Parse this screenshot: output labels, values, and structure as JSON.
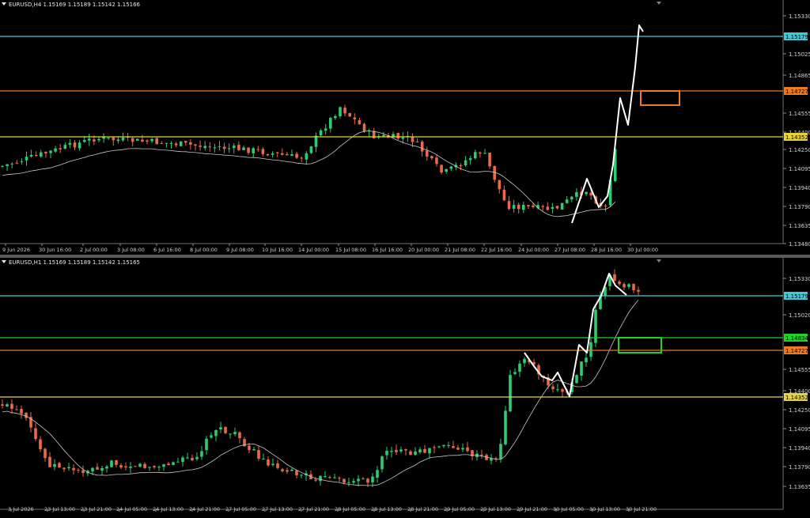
{
  "colors": {
    "background": "#000000",
    "grid": "#3a3a3a",
    "bull": "#2ecc71",
    "bear": "#e86a4a",
    "axis_text": "#d0d0d0",
    "ma": "#c8c8c8",
    "trace": "#ffffff",
    "level_cyan": "#3fc9d8",
    "level_orange": "#e87b24",
    "level_yellow": "#e6d23c",
    "level_green": "#22d12a",
    "box_orange": "#e87b24",
    "box_green": "#22d12a"
  },
  "icons": {
    "menu_marker": "triangle-down-icon"
  },
  "panes": [
    {
      "symbol": "EURUSD,H4",
      "ohlc": "1.15169 1.15189 1.15142 1.15166",
      "yaxis_ticks": [
        "1.15330",
        "1.15025",
        "1.14865",
        "1.14555",
        "1.14400",
        "1.14250",
        "1.14095",
        "1.13940",
        "1.13790",
        "1.13635",
        "1.13480"
      ],
      "xaxis_labels": [
        "9 Jun 2026",
        "30 Jun 16:00",
        "2 Jul 00:00",
        "3 Jul 08:00",
        "6 Jul 16:00",
        "8 Jul 00:00",
        "9 Jul 08:00",
        "10 Jul 16:00",
        "14 Jul 00:00",
        "15 Jul 08:00",
        "16 Jul 16:00",
        "20 Jul 00:00",
        "21 Jul 08:00",
        "22 Jul 16:00",
        "24 Jul 00:00",
        "27 Jul 08:00",
        "28 Jul 16:00",
        "30 Jul 00:00"
      ],
      "level_labels": [
        {
          "role": "cyan",
          "text": "1.15179"
        },
        {
          "role": "orange",
          "text": "1.14727"
        },
        {
          "role": "yellow",
          "text": "1.14352"
        }
      ]
    },
    {
      "symbol": "EURUSD,H1",
      "ohlc": "1.15169 1.15189 1.15142 1.15165",
      "yaxis_ticks": [
        "1.15330",
        "1.15020",
        "1.14555",
        "1.14400",
        "1.14250",
        "1.14095",
        "1.13940",
        "1.13790",
        "1.13635"
      ],
      "xaxis_labels": [
        "3 Jul 2026",
        "23 Jul 13:00",
        "23 Jul 21:00",
        "24 Jul 05:00",
        "24 Jul 13:00",
        "24 Jul 21:00",
        "27 Jul 05:00",
        "27 Jul 13:00",
        "27 Jul 21:00",
        "28 Jul 05:00",
        "28 Jul 13:00",
        "28 Jul 21:00",
        "29 Jul 05:00",
        "29 Jul 13:00",
        "29 Jul 21:00",
        "30 Jul 05:00",
        "30 Jul 13:00",
        "30 Jul 21:00"
      ],
      "level_labels": [
        {
          "role": "cyan",
          "text": "1.15179"
        },
        {
          "role": "green",
          "text": "1.14834"
        },
        {
          "role": "orange",
          "text": "1.14727"
        },
        {
          "role": "yellow",
          "text": "1.14352"
        }
      ]
    }
  ]
}
